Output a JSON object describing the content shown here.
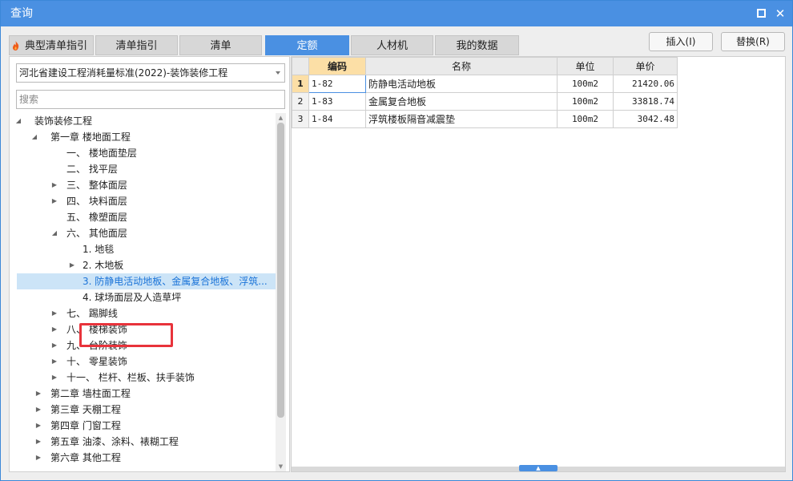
{
  "window": {
    "title": "查询"
  },
  "tabs": [
    {
      "label": "典型清单指引"
    },
    {
      "label": "清单指引"
    },
    {
      "label": "清单"
    },
    {
      "label": "定额"
    },
    {
      "label": "人材机"
    },
    {
      "label": "我的数据"
    }
  ],
  "actions": {
    "insert": "插入(I)",
    "replace": "替换(R)"
  },
  "left": {
    "library": "河北省建设工程消耗量标准(2022)-装饰装修工程",
    "search_placeholder": "搜索",
    "tree": [
      {
        "label": "装饰装修工程",
        "expanded": true
      },
      {
        "label": "第一章 楼地面工程",
        "expanded": true
      },
      {
        "label": "一、 楼地面垫层"
      },
      {
        "label": "二、 找平层"
      },
      {
        "label": "三、 整体面层",
        "expanded": false
      },
      {
        "label": "四、 块料面层",
        "expanded": false
      },
      {
        "label": "五、 橡塑面层"
      },
      {
        "label": "六、 其他面层",
        "expanded": true
      },
      {
        "label": "1. 地毯"
      },
      {
        "label": "2. 木地板",
        "expanded": false
      },
      {
        "label": "3. 防静电活动地板、金属复合地板、浮筑...",
        "selected": true
      },
      {
        "label": "4. 球场面层及人造草坪"
      },
      {
        "label": "七、 踢脚线",
        "expanded": false
      },
      {
        "label": "八、 楼梯装饰",
        "expanded": false
      },
      {
        "label": "九、 台阶装饰",
        "expanded": false
      },
      {
        "label": "十、 零星装饰",
        "expanded": false
      },
      {
        "label": "十一、 栏杆、栏板、扶手装饰",
        "expanded": false
      },
      {
        "label": "第二章 墙柱面工程",
        "expanded": false
      },
      {
        "label": "第三章 天棚工程",
        "expanded": false
      },
      {
        "label": "第四章 门窗工程",
        "expanded": false
      },
      {
        "label": "第五章 油漆、涂料、裱糊工程",
        "expanded": false
      },
      {
        "label": "第六章 其他工程",
        "expanded": false
      }
    ]
  },
  "grid": {
    "headers": {
      "code": "编码",
      "name": "名称",
      "unit": "单位",
      "price": "单价"
    },
    "rows": [
      {
        "index": "1",
        "code": "1-82",
        "name": "防静电活动地板",
        "unit": "100m2",
        "price": "21420.06"
      },
      {
        "index": "2",
        "code": "1-83",
        "name": "金属复合地板",
        "unit": "100m2",
        "price": "33818.74"
      },
      {
        "index": "3",
        "code": "1-84",
        "name": "浮筑楼板隔音减震垫",
        "unit": "100m2",
        "price": "3042.48"
      }
    ]
  },
  "colors": {
    "accent": "#4a90e2",
    "selection": "#cce4f7",
    "highlight_box": "#e8333b",
    "header_highlight": "#fcdfa6"
  }
}
